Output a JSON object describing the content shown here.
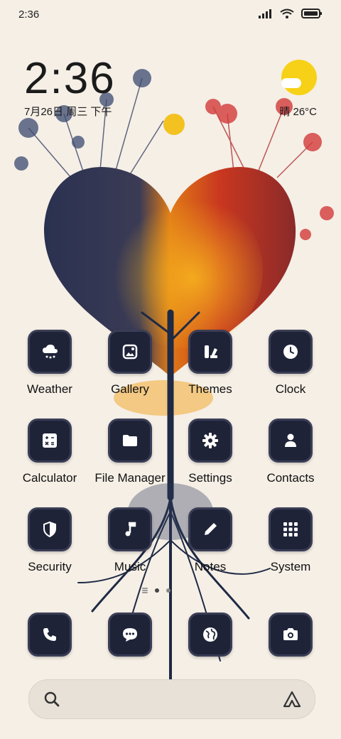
{
  "status": {
    "time": "2:36"
  },
  "clock_widget": {
    "time": "2:36",
    "date": "7月26日 周三 下午"
  },
  "weather_widget": {
    "text": "晴 26°C"
  },
  "apps": [
    {
      "label": "Weather",
      "icon": "cloud-rain-icon"
    },
    {
      "label": "Gallery",
      "icon": "image-icon"
    },
    {
      "label": "Themes",
      "icon": "brush-icon"
    },
    {
      "label": "Clock",
      "icon": "clock-icon"
    },
    {
      "label": "Calculator",
      "icon": "calculator-icon"
    },
    {
      "label": "File Manager",
      "icon": "folder-icon"
    },
    {
      "label": "Settings",
      "icon": "gear-icon"
    },
    {
      "label": "Contacts",
      "icon": "person-icon"
    },
    {
      "label": "Security",
      "icon": "shield-icon"
    },
    {
      "label": "Music",
      "icon": "music-note-icon"
    },
    {
      "label": "Notes",
      "icon": "pencil-icon"
    },
    {
      "label": "System",
      "icon": "folder-grid-icon"
    }
  ],
  "dock": [
    {
      "icon": "phone-icon"
    },
    {
      "icon": "message-icon"
    },
    {
      "icon": "globe-icon"
    },
    {
      "icon": "camera-icon"
    }
  ],
  "colors": {
    "background": "#f5efe6",
    "tile": "#1e2338",
    "sun": "#f7d117"
  }
}
